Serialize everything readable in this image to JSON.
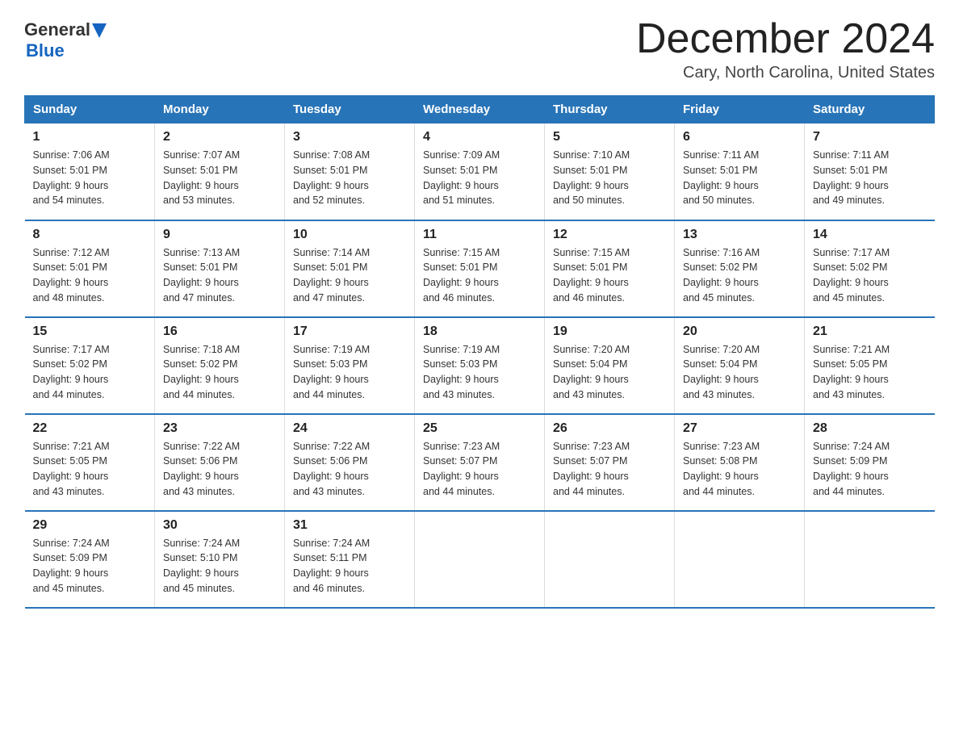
{
  "header": {
    "logo_general": "General",
    "logo_arrow": "▶",
    "logo_blue": "Blue",
    "month": "December 2024",
    "location": "Cary, North Carolina, United States"
  },
  "days_of_week": [
    "Sunday",
    "Monday",
    "Tuesday",
    "Wednesday",
    "Thursday",
    "Friday",
    "Saturday"
  ],
  "weeks": [
    [
      {
        "day": "1",
        "sunrise": "7:06 AM",
        "sunset": "5:01 PM",
        "daylight": "9 hours and 54 minutes."
      },
      {
        "day": "2",
        "sunrise": "7:07 AM",
        "sunset": "5:01 PM",
        "daylight": "9 hours and 53 minutes."
      },
      {
        "day": "3",
        "sunrise": "7:08 AM",
        "sunset": "5:01 PM",
        "daylight": "9 hours and 52 minutes."
      },
      {
        "day": "4",
        "sunrise": "7:09 AM",
        "sunset": "5:01 PM",
        "daylight": "9 hours and 51 minutes."
      },
      {
        "day": "5",
        "sunrise": "7:10 AM",
        "sunset": "5:01 PM",
        "daylight": "9 hours and 50 minutes."
      },
      {
        "day": "6",
        "sunrise": "7:11 AM",
        "sunset": "5:01 PM",
        "daylight": "9 hours and 50 minutes."
      },
      {
        "day": "7",
        "sunrise": "7:11 AM",
        "sunset": "5:01 PM",
        "daylight": "9 hours and 49 minutes."
      }
    ],
    [
      {
        "day": "8",
        "sunrise": "7:12 AM",
        "sunset": "5:01 PM",
        "daylight": "9 hours and 48 minutes."
      },
      {
        "day": "9",
        "sunrise": "7:13 AM",
        "sunset": "5:01 PM",
        "daylight": "9 hours and 47 minutes."
      },
      {
        "day": "10",
        "sunrise": "7:14 AM",
        "sunset": "5:01 PM",
        "daylight": "9 hours and 47 minutes."
      },
      {
        "day": "11",
        "sunrise": "7:15 AM",
        "sunset": "5:01 PM",
        "daylight": "9 hours and 46 minutes."
      },
      {
        "day": "12",
        "sunrise": "7:15 AM",
        "sunset": "5:01 PM",
        "daylight": "9 hours and 46 minutes."
      },
      {
        "day": "13",
        "sunrise": "7:16 AM",
        "sunset": "5:02 PM",
        "daylight": "9 hours and 45 minutes."
      },
      {
        "day": "14",
        "sunrise": "7:17 AM",
        "sunset": "5:02 PM",
        "daylight": "9 hours and 45 minutes."
      }
    ],
    [
      {
        "day": "15",
        "sunrise": "7:17 AM",
        "sunset": "5:02 PM",
        "daylight": "9 hours and 44 minutes."
      },
      {
        "day": "16",
        "sunrise": "7:18 AM",
        "sunset": "5:02 PM",
        "daylight": "9 hours and 44 minutes."
      },
      {
        "day": "17",
        "sunrise": "7:19 AM",
        "sunset": "5:03 PM",
        "daylight": "9 hours and 44 minutes."
      },
      {
        "day": "18",
        "sunrise": "7:19 AM",
        "sunset": "5:03 PM",
        "daylight": "9 hours and 43 minutes."
      },
      {
        "day": "19",
        "sunrise": "7:20 AM",
        "sunset": "5:04 PM",
        "daylight": "9 hours and 43 minutes."
      },
      {
        "day": "20",
        "sunrise": "7:20 AM",
        "sunset": "5:04 PM",
        "daylight": "9 hours and 43 minutes."
      },
      {
        "day": "21",
        "sunrise": "7:21 AM",
        "sunset": "5:05 PM",
        "daylight": "9 hours and 43 minutes."
      }
    ],
    [
      {
        "day": "22",
        "sunrise": "7:21 AM",
        "sunset": "5:05 PM",
        "daylight": "9 hours and 43 minutes."
      },
      {
        "day": "23",
        "sunrise": "7:22 AM",
        "sunset": "5:06 PM",
        "daylight": "9 hours and 43 minutes."
      },
      {
        "day": "24",
        "sunrise": "7:22 AM",
        "sunset": "5:06 PM",
        "daylight": "9 hours and 43 minutes."
      },
      {
        "day": "25",
        "sunrise": "7:23 AM",
        "sunset": "5:07 PM",
        "daylight": "9 hours and 44 minutes."
      },
      {
        "day": "26",
        "sunrise": "7:23 AM",
        "sunset": "5:07 PM",
        "daylight": "9 hours and 44 minutes."
      },
      {
        "day": "27",
        "sunrise": "7:23 AM",
        "sunset": "5:08 PM",
        "daylight": "9 hours and 44 minutes."
      },
      {
        "day": "28",
        "sunrise": "7:24 AM",
        "sunset": "5:09 PM",
        "daylight": "9 hours and 44 minutes."
      }
    ],
    [
      {
        "day": "29",
        "sunrise": "7:24 AM",
        "sunset": "5:09 PM",
        "daylight": "9 hours and 45 minutes."
      },
      {
        "day": "30",
        "sunrise": "7:24 AM",
        "sunset": "5:10 PM",
        "daylight": "9 hours and 45 minutes."
      },
      {
        "day": "31",
        "sunrise": "7:24 AM",
        "sunset": "5:11 PM",
        "daylight": "9 hours and 46 minutes."
      },
      null,
      null,
      null,
      null
    ]
  ],
  "labels": {
    "sunrise": "Sunrise: ",
    "sunset": "Sunset: ",
    "daylight": "Daylight: "
  }
}
